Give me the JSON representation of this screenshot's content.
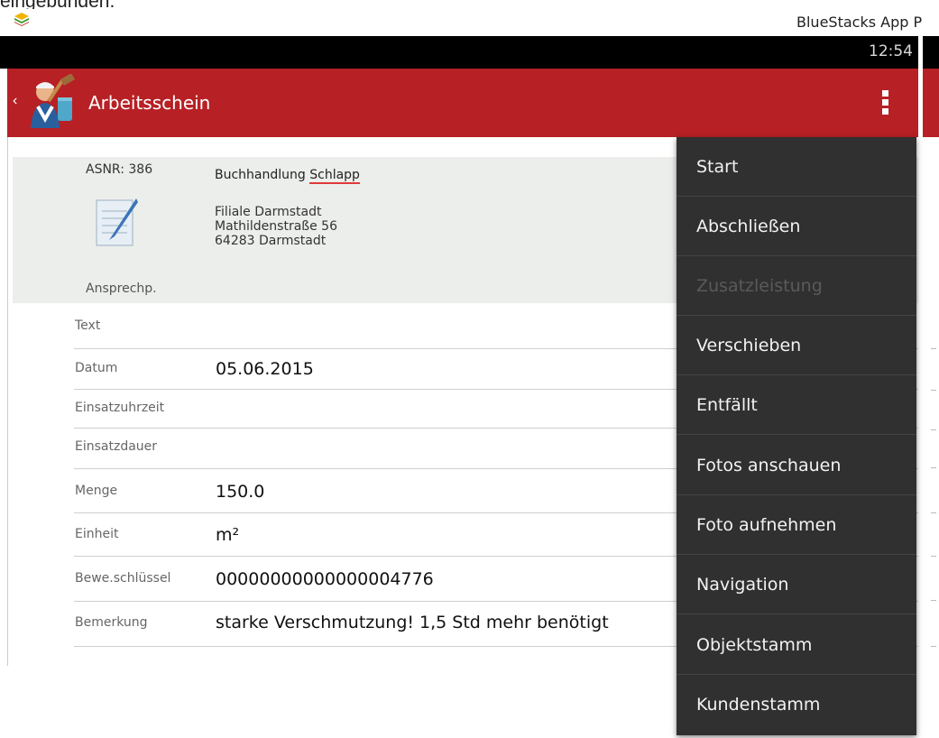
{
  "page": {
    "top_caption": "eingebunden."
  },
  "host": {
    "title": "BlueStacks App P",
    "logo_icon": "bluestacks-logo-icon"
  },
  "status_bar": {
    "time": "12:54"
  },
  "action_bar": {
    "title": "Arbeitsschein",
    "back_icon": "chevron-left-icon",
    "menu_icon": "overflow-menu-icon",
    "accent_color": "#b72025"
  },
  "header": {
    "asnr": "ASNR: 386",
    "customer_prefix": "Buchhandlung ",
    "customer_underlined": "Schlapp",
    "address_lines": [
      "Filiale Darmstadt",
      "Mathildenstraße 56",
      "64283 Darmstadt"
    ],
    "contact_label": "Ansprechp."
  },
  "fields": [
    {
      "label": "Text",
      "value": ""
    },
    {
      "label": "Datum",
      "value": "05.06.2015"
    },
    {
      "label": "Einsatzuhrzeit",
      "value": ""
    },
    {
      "label": "Einsatzdauer",
      "value": ""
    },
    {
      "label": "Menge",
      "value": "150.0"
    },
    {
      "label": "Einheit",
      "value": "m²"
    },
    {
      "label": "Bewe.schlüssel",
      "value": "00000000000000004776"
    },
    {
      "label": "Bemerkung",
      "value": "starke Verschmutzung! 1,5 Std mehr benötigt"
    }
  ],
  "menu": {
    "items": [
      {
        "label": "Start",
        "enabled": true
      },
      {
        "label": "Abschließen",
        "enabled": true
      },
      {
        "label": "Zusatzleistung",
        "enabled": false
      },
      {
        "label": "Verschieben",
        "enabled": true
      },
      {
        "label": "Entfällt",
        "enabled": true
      },
      {
        "label": "Fotos anschauen",
        "enabled": true
      },
      {
        "label": "Foto aufnehmen",
        "enabled": true
      },
      {
        "label": "Navigation",
        "enabled": true
      },
      {
        "label": "Objektstamm",
        "enabled": true
      },
      {
        "label": "Kundenstamm",
        "enabled": true
      }
    ]
  }
}
